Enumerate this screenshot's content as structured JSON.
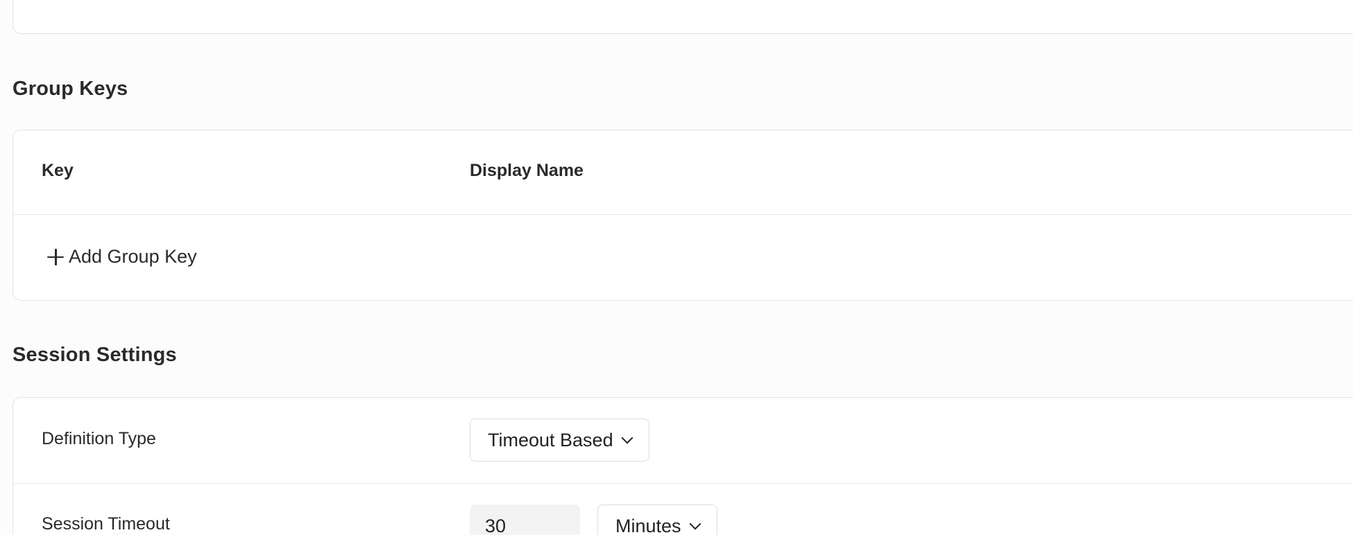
{
  "group_keys": {
    "heading": "Group Keys",
    "columns": [
      "Key",
      "Display Name"
    ],
    "add_button_label": "Add Group Key"
  },
  "session_settings": {
    "heading": "Session Settings",
    "rows": [
      {
        "label": "Definition Type",
        "select_value": "Timeout Based"
      },
      {
        "label": "Session Timeout",
        "input_value": "30",
        "unit_value": "Minutes"
      }
    ]
  },
  "icons": {
    "add": "plus-icon",
    "dropdown": "chevron-down-icon"
  }
}
